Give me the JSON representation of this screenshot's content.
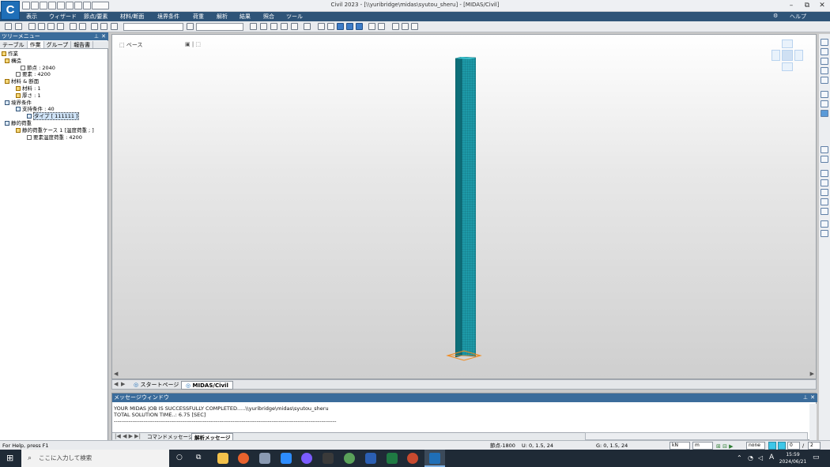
{
  "window": {
    "title": "Civil 2023 - [\\\\yuribridge\\midas\\syutou_sheru] - [MIDAS/Civil]",
    "logo_letter": "C"
  },
  "menu": {
    "items": [
      "表示",
      "ウィザード",
      "節点/要素",
      "材料/断面",
      "境界条件",
      "荷重",
      "解析",
      "結果",
      "照合",
      "ツール"
    ],
    "help_label": "ヘルプ"
  },
  "tree": {
    "header": "ツリーメニュー",
    "tabs": [
      "テーブル",
      "作業",
      "グループ",
      "報告書"
    ],
    "active_tab": "作業",
    "nodes": [
      {
        "level": 0,
        "text": "作業"
      },
      {
        "level": 1,
        "text": "構造"
      },
      {
        "level": 2,
        "text": "節点 : 2040"
      },
      {
        "level": 2,
        "text": "要素 : 4200"
      },
      {
        "level": 1,
        "text": "材料 & 断面"
      },
      {
        "level": 2,
        "text": "材料 : 1"
      },
      {
        "level": 2,
        "text": "厚さ : 1"
      },
      {
        "level": 1,
        "text": "境界条件"
      },
      {
        "level": 2,
        "text": "支持条件 : 40"
      },
      {
        "level": 3,
        "text": "タイプ [ 111111 ]"
      },
      {
        "level": 1,
        "text": "静的荷重"
      },
      {
        "level": 2,
        "text": "静的荷重ケース 1 [温度荷重 ; ]"
      },
      {
        "level": 3,
        "text": "要素温度荷重 : 4200"
      }
    ]
  },
  "viewport": {
    "view_label": "ベース"
  },
  "doc_tabs": {
    "tabs": [
      "スタートページ",
      "MIDAS/Civil"
    ],
    "active": "MIDAS/Civil"
  },
  "message_window": {
    "title": "メッセージウィンドウ",
    "lines": [
      "YOUR MIDAS JOB IS SUCCESSFULLY COMPLETED.....\\\\yuribridge\\midas\\syutou_sheru",
      "TOTAL SOLUTION TIME..:    6.75 [SEC]",
      "------------------------------------------------------------------------------------------------------------------------"
    ],
    "tabs": [
      "コマンドメッセージ",
      "解析メッセージ"
    ],
    "active_tab": "解析メッセージ"
  },
  "status": {
    "help_text": "For Help, press F1",
    "node": "節点-1800",
    "u_coord": "U: 0, 1.5, 24",
    "g_coord": "G: 0, 1.5, 24",
    "force_unit": "kN",
    "length_unit": "m",
    "filter": "none",
    "page_current": "0",
    "page_total": "2"
  },
  "taskbar": {
    "search_placeholder": "ここに入力して検索",
    "time": "15:59",
    "date": "2024/06/21",
    "ime": "A"
  },
  "colors": {
    "menubar": "#2f5478",
    "panel_header": "#3b6c9b",
    "column_teal": "#1d9aa8",
    "column_dark": "#0d6f79",
    "taskbar": "#1f2a36"
  }
}
